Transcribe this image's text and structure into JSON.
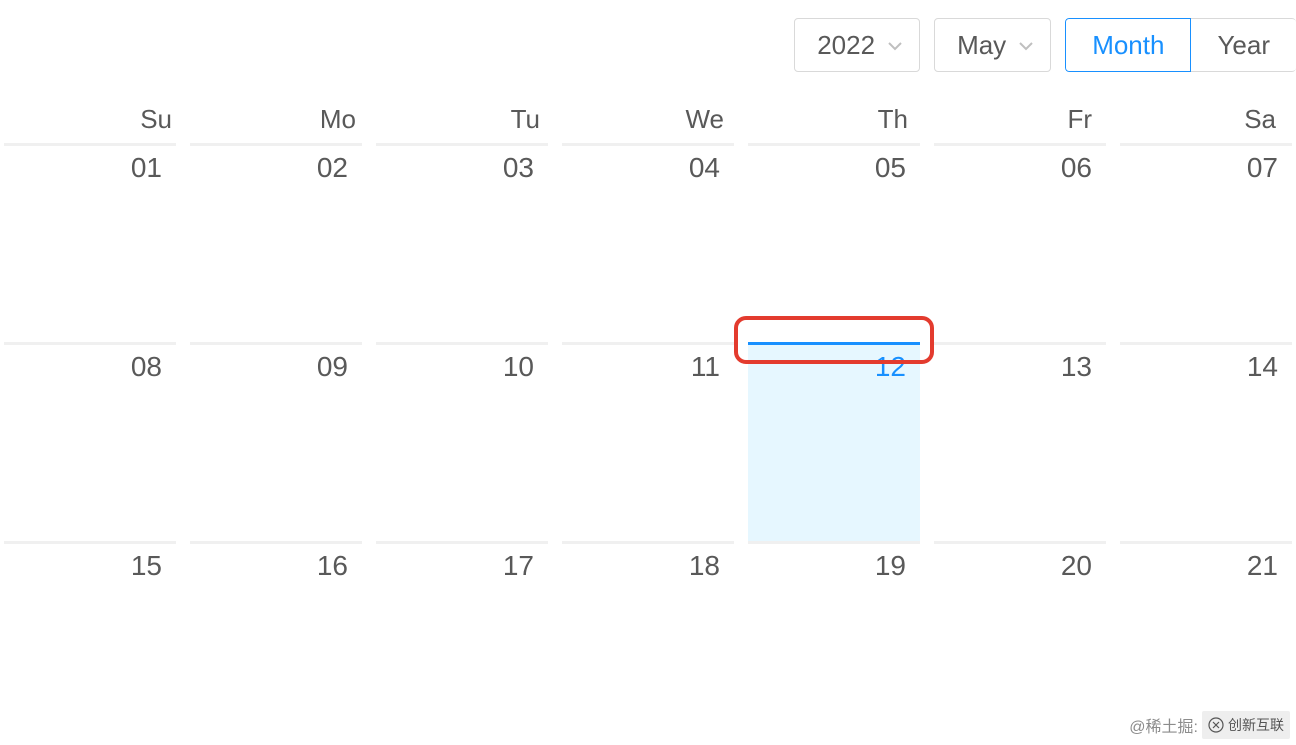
{
  "header": {
    "year": "2022",
    "month": "May",
    "view_month": "Month",
    "view_year": "Year",
    "active_view": "month"
  },
  "weekdays": [
    "Su",
    "Mo",
    "Tu",
    "We",
    "Th",
    "Fr",
    "Sa"
  ],
  "weeks": [
    [
      "01",
      "02",
      "03",
      "04",
      "05",
      "06",
      "07"
    ],
    [
      "08",
      "09",
      "10",
      "11",
      "12",
      "13",
      "14"
    ],
    [
      "15",
      "16",
      "17",
      "18",
      "19",
      "20",
      "21"
    ]
  ],
  "today": "12",
  "watermark": {
    "text": "@稀土掘:",
    "brand": "创新互联"
  }
}
